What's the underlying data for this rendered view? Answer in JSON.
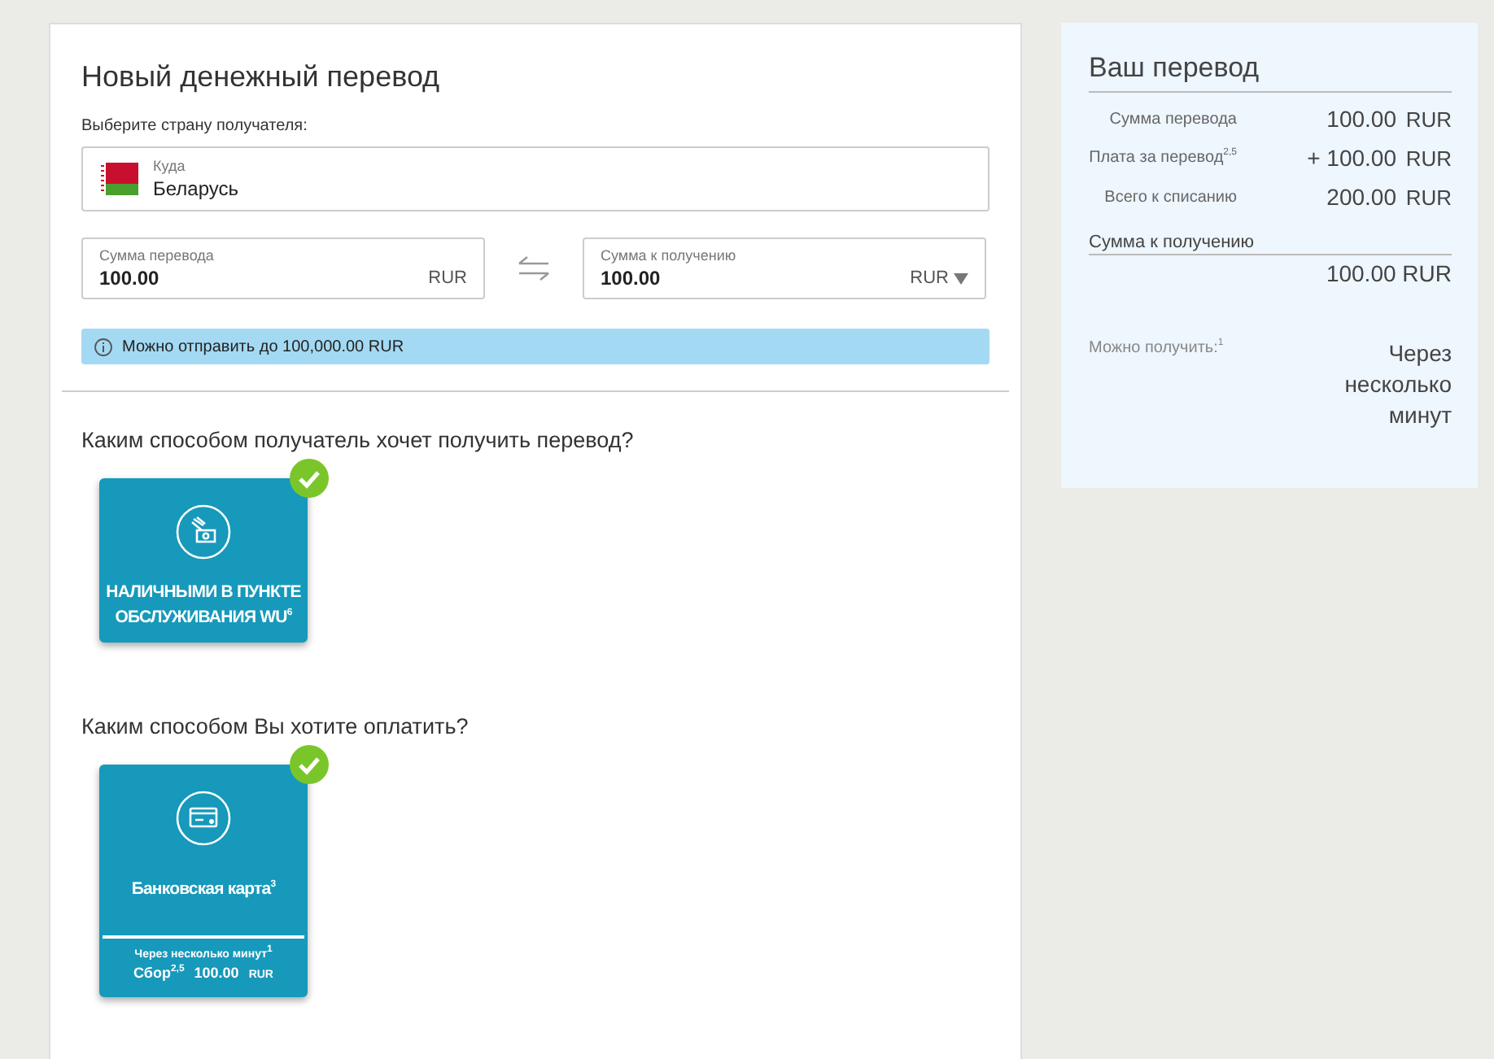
{
  "title": "Новый денежный перевод",
  "country_prompt": "Выберите страну получателя:",
  "destination": {
    "label": "Куда",
    "value": "Беларусь"
  },
  "amount_send": {
    "label": "Сумма перевода",
    "value": "100.00",
    "currency": "RUR"
  },
  "amount_receive": {
    "label": "Сумма к получению",
    "value": "100.00",
    "currency": "RUR"
  },
  "info": "Можно отправить до 100,000.00 RUR",
  "receive_question": "Каким способом получатель хочет получить перевод?",
  "receive_options": [
    {
      "kind": "cash",
      "label": "НАЛИЧНЫМИ В ПУНКТЕ ОБСЛУЖИВАНИЯ WU$^{6}$",
      "selected": true
    }
  ],
  "pay_question": "Каким способом Вы хотите оплатить?",
  "pay_options": [
    {
      "kind": "card",
      "label": "Банковская карта$^{3}$",
      "selected": true,
      "note": "Через несколько минут$^{1}$",
      "fee_label": "Сбор$^{2,5}$",
      "fee_value": "100.00",
      "fee_currency": "RUR"
    }
  ],
  "summary": {
    "title": "Ваш перевод",
    "rows": [
      {
        "label": "Сумма перевода",
        "value": "100.00",
        "currency": "RUR"
      },
      {
        "label": "Плата за перевод$^{2,5}$",
        "value": "+ 100.00",
        "currency": "RUR"
      },
      {
        "label": "Всего к списанию",
        "value": "200.00",
        "currency": "RUR"
      }
    ],
    "receive_label": "Сумма к получению",
    "receive_value": "100.00 RUR",
    "available_label": "Можно получить:$^{1}$",
    "available_value": "Через несколько минут"
  }
}
